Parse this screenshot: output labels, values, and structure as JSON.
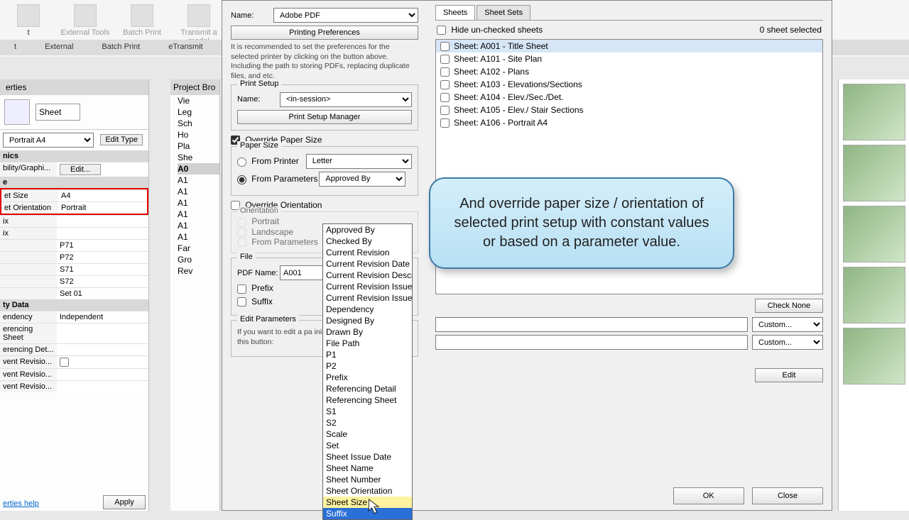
{
  "ribbon": {
    "items": [
      "t",
      "External Tools",
      "Batch Print",
      "Transmit a model"
    ],
    "bar": [
      "t",
      "External",
      "Batch Print",
      "eTransmit"
    ]
  },
  "props": {
    "title": "erties",
    "type": "Sheet",
    "instance": "Portrait A4",
    "edit_type": "Edit Type",
    "cat_graphics": "nics",
    "graphics_key": "bility/Graphi...",
    "graphics_btn": "Edit...",
    "cat_other": "e",
    "rows": [
      {
        "k": "et Size",
        "v": "A4"
      },
      {
        "k": "et Orientation",
        "v": "Portrait"
      },
      {
        "k": "ix",
        "v": ""
      },
      {
        "k": "ix",
        "v": ""
      },
      {
        "k": "",
        "v": "P71"
      },
      {
        "k": "",
        "v": "P72"
      },
      {
        "k": "",
        "v": "S71"
      },
      {
        "k": "",
        "v": "S72"
      },
      {
        "k": "",
        "v": "Set 01"
      }
    ],
    "cat_identity": "ty Data",
    "identity_rows": [
      {
        "k": "endency",
        "v": "Independent"
      },
      {
        "k": "erencing Sheet",
        "v": ""
      },
      {
        "k": "erencing Det...",
        "v": ""
      },
      {
        "k": "vent Revisio...",
        "v": ""
      },
      {
        "k": "vent Revisio...",
        "v": ""
      },
      {
        "k": "vent Revisio...",
        "v": ""
      }
    ],
    "help": "erties help",
    "apply": "Apply"
  },
  "browser": {
    "title": "Project Bro",
    "items": [
      "Vie",
      "Leg",
      "Sch",
      "Ho",
      "Pla",
      "She",
      "A0",
      "A1",
      "A1",
      "A1",
      "A1",
      "A1",
      "A1",
      "Far",
      "Gro",
      "Rev"
    ]
  },
  "dlg": {
    "name_lbl": "Name:",
    "printer": "Adobe PDF",
    "pref_btn": "Printing Preferences",
    "note": "It is recommended to set the preferences for the selected printer by clicking on the button above. Including the path to storing PDFs, replacing duplicate files, and etc.",
    "setup_title": "Print Setup",
    "setup_name": "<in-session>",
    "setup_mgr": "Print Setup Manager",
    "override_paper": "Override Paper Size",
    "paper_size_title": "Paper Size",
    "from_printer": "From Printer",
    "from_params": "From Parameters",
    "letter": "Letter",
    "approved": "Approved By",
    "override_orient": "Override Orientation",
    "orient_title": "Orientation",
    "portrait": "Portrait",
    "landscape": "Landscape",
    "from_params2": "From Parameters",
    "file_title": "File",
    "pdf_name_lbl": "PDF Name:",
    "pdf_name": "A001",
    "prefix": "Prefix",
    "suffix": "Suffix",
    "custom": "Custom...",
    "edit_params_title": "Edit Parameters",
    "edit_params_note": "If you want to edit a pa                                         ining other parameters click this button:",
    "edit_btn": "Edit",
    "ok": "OK",
    "close": "Close",
    "tabs": {
      "sheets": "Sheets",
      "sets": "Sheet Sets"
    },
    "hide": "Hide un-checked sheets",
    "count": "0 sheet selected",
    "sheets": [
      "Sheet: A001 - Title Sheet",
      "Sheet: A101 - Site Plan",
      "Sheet: A102 - Plans",
      "Sheet: A103 - Elevations/Sections",
      "Sheet: A104 - Elev./Sec./Det.",
      "Sheet: A105 - Elev./ Stair Sections",
      "Sheet: A106 - Portrait A4"
    ],
    "check_none": "Check None"
  },
  "dropdown": [
    "Approved By",
    "Checked By",
    "Current Revision",
    "Current Revision Date",
    "Current Revision Descr",
    "Current Revision Issued",
    "Current Revision Issued",
    "Dependency",
    "Designed By",
    "Drawn By",
    "File Path",
    "P1",
    "P2",
    "Prefix",
    "Referencing Detail",
    "Referencing Sheet",
    "S1",
    "S2",
    "Scale",
    "Set",
    "Sheet Issue Date",
    "Sheet Name",
    "Sheet Number",
    "Sheet Orientation",
    "Sheet Size",
    "Suffix"
  ],
  "bubble": "And override paper size / orientation of selected print setup with constant values or based on a parameter value."
}
